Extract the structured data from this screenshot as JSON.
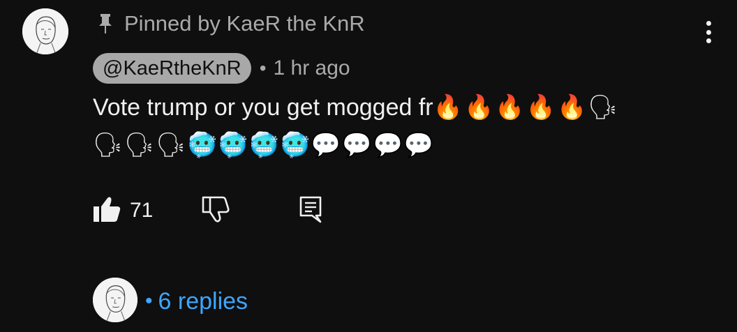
{
  "comment": {
    "pinned_text": "Pinned by KaeR the KnR",
    "author": "@KaeRtheKnR",
    "separator": "•",
    "timestamp": "1 hr ago",
    "text_line1": "Vote trump or you get mogged fr",
    "text_line1_emoji": "🔥🔥🔥🔥🔥🗣",
    "text_line2_emoji": "🗣🗣🗣🥶🥶🥶🥶💬💬💬💬",
    "like_count": "71",
    "replies_separator": "•",
    "replies_label": "6 replies",
    "icons": {
      "pin": "pin-icon",
      "more": "more-vertical-icon",
      "like": "thumbs-up-filled-icon",
      "dislike": "thumbs-down-outline-icon",
      "reply": "comment-reply-icon"
    },
    "colors": {
      "background": "#0f0f0f",
      "secondary_text": "#aaaaaa",
      "author_chip": "#a8a8a8",
      "link": "#3ea6ff"
    }
  }
}
